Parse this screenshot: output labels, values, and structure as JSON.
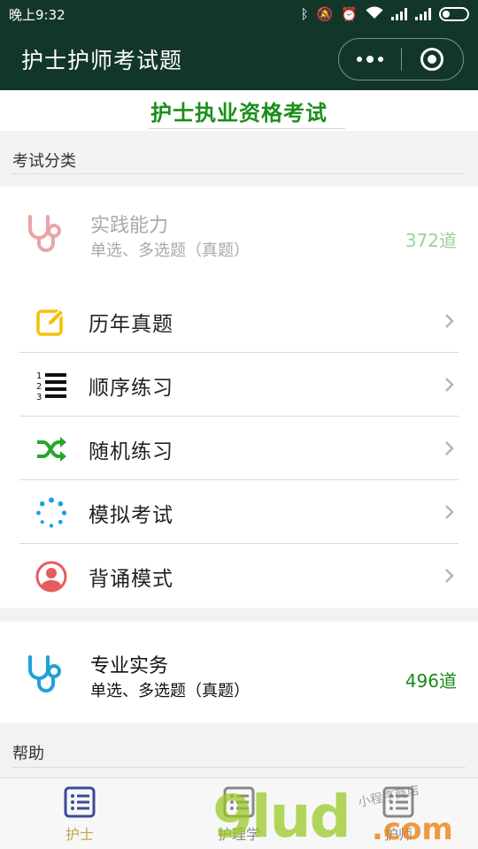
{
  "status_bar": {
    "time": "晚上9:32"
  },
  "header": {
    "title": "护士护师考试题"
  },
  "banner": {
    "title": "护士执业资格考试"
  },
  "sections": {
    "exam_category": "考试分类",
    "help": "帮助"
  },
  "categories": [
    {
      "name": "实践能力",
      "subtitle": "单选、多选题（真题）",
      "count": "372道",
      "state": "faded",
      "icon": "stethoscope-icon",
      "icon_color": "#e8a5a5"
    },
    {
      "name": "专业实务",
      "subtitle": "单选、多选题（真题）",
      "count": "496道",
      "state": "active",
      "icon": "stethoscope-icon",
      "icon_color": "#1fa2d6"
    }
  ],
  "menu": [
    {
      "label": "历年真题",
      "icon": "edit-icon",
      "icon_color": "#f2c200"
    },
    {
      "label": "顺序练习",
      "icon": "numbered-list-icon",
      "icon_color": "#111111"
    },
    {
      "label": "随机练习",
      "icon": "shuffle-icon",
      "icon_color": "#2aa52a"
    },
    {
      "label": "模拟考试",
      "icon": "loading-dots-icon",
      "icon_color": "#1ea0dc"
    },
    {
      "label": "背诵模式",
      "icon": "user-avatar-icon",
      "icon_color": "#e65c5c"
    }
  ],
  "tabs": [
    {
      "label": "护士",
      "selected": true,
      "icon": "list-icon"
    },
    {
      "label": "护理学",
      "selected": false,
      "icon": "list-icon"
    },
    {
      "label": "护师",
      "selected": false,
      "icon": "list-icon"
    }
  ],
  "watermark": {
    "brand": "9lud",
    "suffix": ".com",
    "note": "小程序商店"
  },
  "colors": {
    "header_bg": "#13362a",
    "accent_green": "#1a8f1a",
    "tab_selected": "#c9a14a"
  }
}
